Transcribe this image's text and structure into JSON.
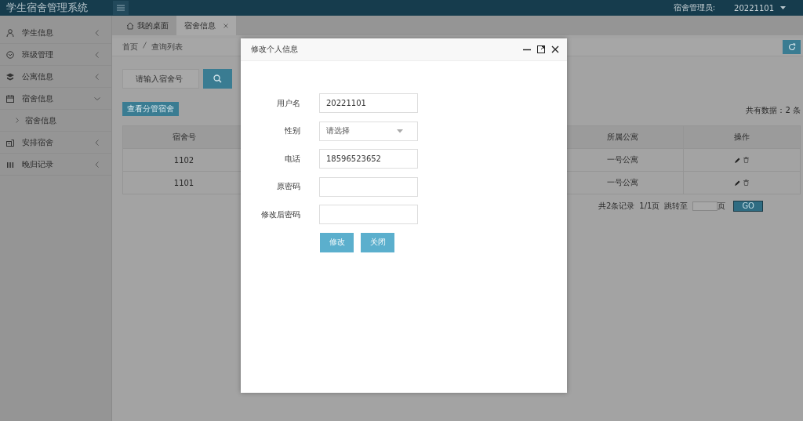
{
  "header": {
    "title": "学生宿舍管理系统",
    "admin_label": "宿舍管理员:",
    "admin_name": "20221101"
  },
  "sidebar": {
    "items": [
      {
        "label": "学生信息",
        "expanded": false
      },
      {
        "label": "班级管理",
        "expanded": false
      },
      {
        "label": "公寓信息",
        "expanded": false
      },
      {
        "label": "宿舍信息",
        "expanded": true,
        "children": [
          {
            "label": "宿舍信息"
          }
        ]
      },
      {
        "label": "安排宿舍",
        "expanded": false
      },
      {
        "label": "晚归记录",
        "expanded": false
      }
    ]
  },
  "tabs": [
    {
      "label": "我的桌面",
      "selected": false,
      "home": true
    },
    {
      "label": "宿舍信息",
      "selected": true,
      "closable": true
    }
  ],
  "breadcrumb": [
    "首页",
    "查询列表"
  ],
  "search": {
    "placeholder": "请输入宿舍号"
  },
  "action_button": "查看分管宿舍",
  "total": "共有数据：2 条",
  "table": {
    "columns": [
      "宿舍号",
      "所属公寓",
      "操作"
    ],
    "rows": [
      {
        "cells": [
          "1102",
          "一号公寓"
        ]
      },
      {
        "cells": [
          "1101",
          "一号公寓"
        ]
      }
    ]
  },
  "pagination": {
    "summary": "共2条记录",
    "pages": "1/1页",
    "jump_label": "跳转至",
    "unit": "页",
    "go": "GO"
  },
  "dialog": {
    "title": "修改个人信息",
    "fields": [
      {
        "label": "用户名",
        "kind": "text",
        "value": "20221101"
      },
      {
        "label": "性别",
        "kind": "select",
        "placeholder": "请选择"
      },
      {
        "label": "电话",
        "kind": "text",
        "value": "18596523652"
      },
      {
        "label": "原密码",
        "kind": "password"
      },
      {
        "label": "修改后密码",
        "kind": "password"
      }
    ],
    "buttons": [
      "修改",
      "关闭"
    ]
  }
}
